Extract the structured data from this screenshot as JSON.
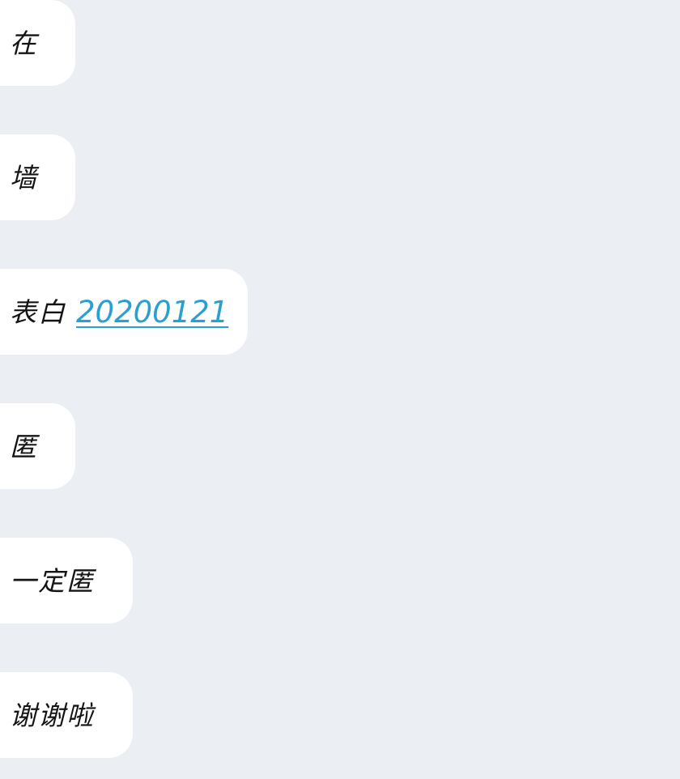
{
  "chat": {
    "messages": [
      {
        "text": "在"
      },
      {
        "text": "墙"
      },
      {
        "text": "表白",
        "link": "20200121"
      },
      {
        "text": "匿"
      },
      {
        "text": "一定匿"
      },
      {
        "text": "谢谢啦"
      }
    ]
  },
  "colors": {
    "background": "#ebeff3",
    "bubble": "#ffffff",
    "text": "#141414",
    "link": "#2a9fd0"
  }
}
